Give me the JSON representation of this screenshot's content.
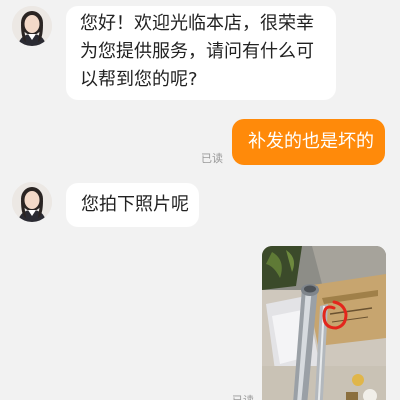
{
  "colors": {
    "background": "#f2f2f2",
    "bubble_left": "#ffffff",
    "bubble_right": "#ff8a0a",
    "read_text": "#9a9a9a"
  },
  "messages": [
    {
      "side": "left",
      "lines": [
        "您好！欢迎光临本店，很荣幸",
        "为您提供服务，请问有什么可",
        "以帮到您的呢?"
      ]
    },
    {
      "side": "right",
      "text": "补发的也是坏的",
      "status": "已读"
    },
    {
      "side": "left",
      "text": "您拍下照片呢"
    },
    {
      "side": "right",
      "type": "image",
      "image_icon": "photo-of-broken-rod-icon",
      "status": "已读"
    }
  ]
}
